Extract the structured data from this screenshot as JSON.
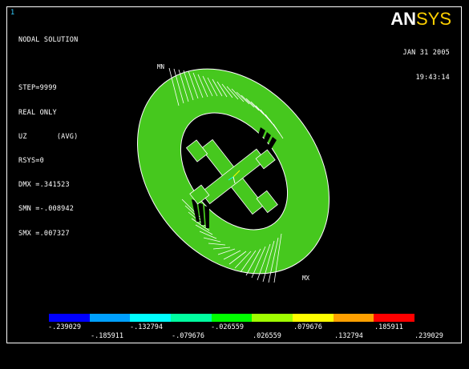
{
  "window_number": "1",
  "info_lines": [
    "NODAL SOLUTION",
    "",
    "STEP=9999",
    "REAL ONLY",
    "UZ       (AVG)",
    "RSYS=0",
    "DMX =.341523",
    "SMN =-.008942",
    "SMX =.007327"
  ],
  "brand": {
    "an": "AN",
    "sys": "SYS"
  },
  "date": "JAN 31 2005",
  "time": "19:43:14",
  "mn_label": "MN",
  "mx_label": "MX",
  "legend": {
    "colors": [
      "#0000ff",
      "#00a0ff",
      "#00ffff",
      "#00ffa0",
      "#00ff00",
      "#a0ff00",
      "#ffff00",
      "#ffa000",
      "#ff0000"
    ],
    "top_labels": [
      "-.239029",
      "-.132794",
      "-.026559",
      ".079676",
      ".185911"
    ],
    "bottom_labels": [
      "-.185911",
      "-.079676",
      ".026559",
      ".132794",
      ".239029"
    ]
  },
  "colors": {
    "model_fill": "#46c81e",
    "model_edge": "#ffffff",
    "background": "#000000"
  }
}
